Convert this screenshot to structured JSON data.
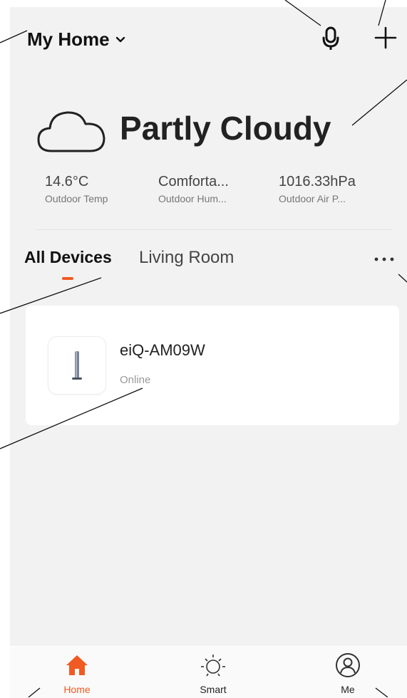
{
  "header": {
    "home_title": "My Home",
    "icons": {
      "chevron": "chevron-down-icon",
      "mic": "microphone-icon",
      "add": "plus-icon"
    }
  },
  "weather": {
    "condition": "Partly Cloudy",
    "icon": "cloud-icon",
    "stats": [
      {
        "value": "14.6°C",
        "label": "Outdoor Temp"
      },
      {
        "value": "Comforta...",
        "label": "Outdoor Hum..."
      },
      {
        "value": "1016.33hPa",
        "label": "Outdoor Air P..."
      }
    ]
  },
  "tabs": [
    {
      "label": "All Devices",
      "active": true
    },
    {
      "label": "Living Room",
      "active": false
    }
  ],
  "more_icon": "more-dots-icon",
  "devices": [
    {
      "name": "eiQ-AM09W",
      "status": "Online",
      "icon": "tower-fan-icon"
    }
  ],
  "tabbar": [
    {
      "label": "Home",
      "icon": "home-icon",
      "active": true
    },
    {
      "label": "Smart",
      "icon": "sun-icon",
      "active": false
    },
    {
      "label": "Me",
      "icon": "user-icon",
      "active": false
    }
  ],
  "colors": {
    "accent": "#f15a22",
    "screen_bg": "#f2f2f2",
    "card_bg": "#ffffff",
    "text_primary": "#1a1a1a",
    "text_secondary": "#777777",
    "tab_inactive": "#444444"
  }
}
